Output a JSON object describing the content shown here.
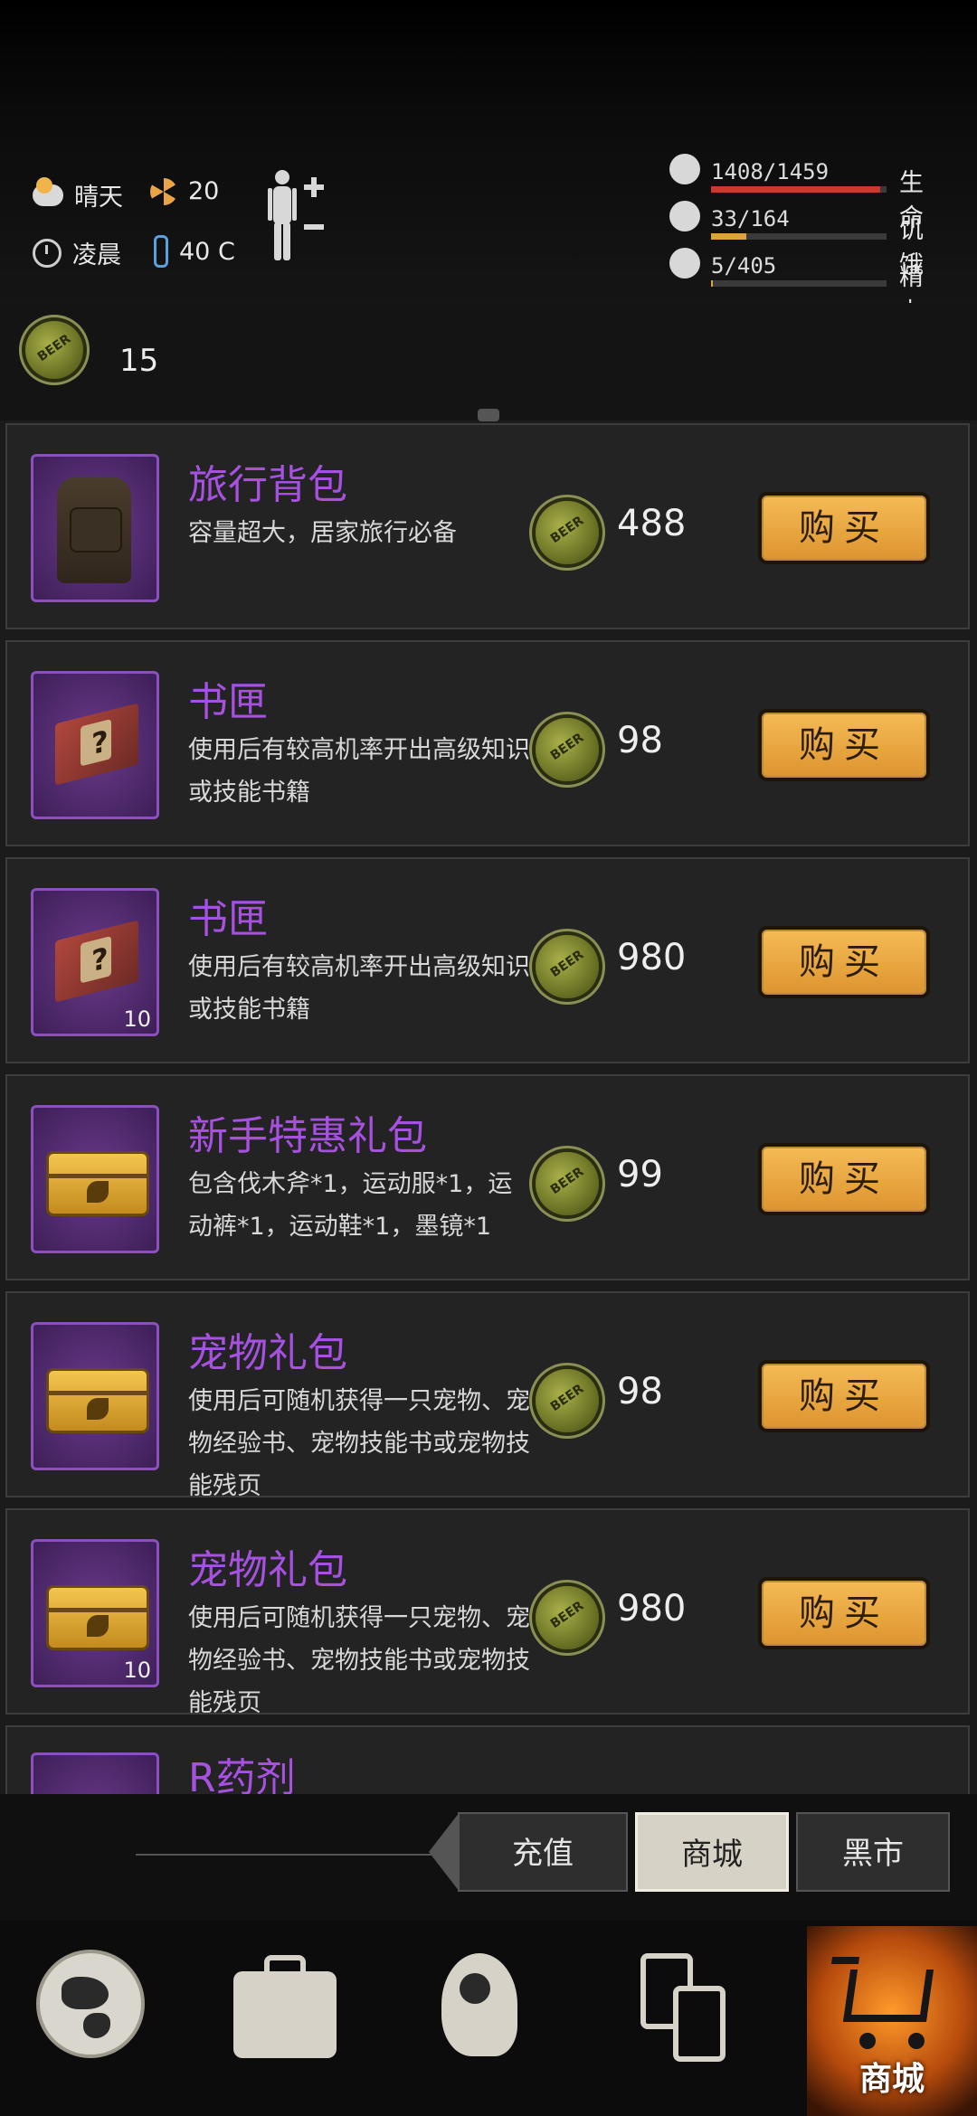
{
  "status": {
    "weather": "晴天",
    "radiation": "20",
    "time_of_day": "凌晨",
    "temperature": "40 C",
    "vitals": [
      {
        "label": "生命",
        "value": "1408/1459",
        "fill": 0.965,
        "color": "#c93a2c",
        "icon": "heart-icon"
      },
      {
        "label": "饥饿",
        "value": "33/164",
        "fill": 0.2,
        "color": "#e0a23a",
        "icon": "stomach-icon"
      },
      {
        "label": "精力",
        "value": "5/405",
        "fill": 0.012,
        "color": "#e0a23a",
        "icon": "brain-icon"
      }
    ]
  },
  "currency": {
    "amount": "15",
    "icon": "bottle-cap-icon"
  },
  "shop": {
    "buy_label": "购买",
    "items": [
      {
        "name": "旅行背包",
        "desc": "容量超大，居家旅行必备",
        "price": "488",
        "count": "",
        "art": "backpack"
      },
      {
        "name": "书匣",
        "desc": "使用后有较高机率开出高级知识或技能书籍",
        "price": "98",
        "count": "",
        "art": "book"
      },
      {
        "name": "书匣",
        "desc": "使用后有较高机率开出高级知识或技能书籍",
        "price": "980",
        "count": "10",
        "art": "book"
      },
      {
        "name": "新手特惠礼包",
        "desc": "包含伐木斧*1，运动服*1，运动裤*1，运动鞋*1，墨镜*1",
        "price": "99",
        "count": "",
        "art": "chest"
      },
      {
        "name": "宠物礼包",
        "desc": "使用后可随机获得一只宠物、宠物经验书、宠物技能书或宠物技能残页",
        "price": "98",
        "count": "",
        "art": "chest"
      },
      {
        "name": "宠物礼包",
        "desc": "使用后可随机获得一只宠物、宠物经验书、宠物技能书或宠物技能残页",
        "price": "980",
        "count": "10",
        "art": "chest"
      },
      {
        "name": "R药剂",
        "desc": "",
        "price": "",
        "count": "",
        "art": "potion"
      }
    ]
  },
  "coin_text": "BEER",
  "tabs": {
    "recharge": "充值",
    "shop": "商城",
    "black_market": "黑市"
  },
  "nav": {
    "shop_label": "商城"
  }
}
